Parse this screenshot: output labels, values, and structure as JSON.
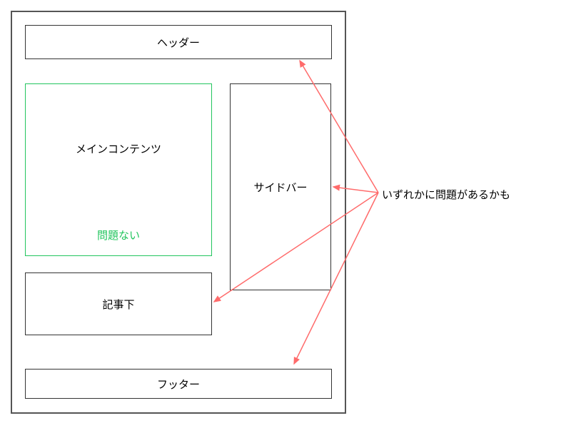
{
  "wireframe": {
    "header": "ヘッダー",
    "main": "メインコンテンツ",
    "main_note": "問題ない",
    "sidebar": "サイドバー",
    "below_article": "記事下",
    "footer": "フッター"
  },
  "annotation": "いずれかに問題があるかも",
  "colors": {
    "ok_border": "#22c55e",
    "arrow": "#ff6b6b"
  }
}
